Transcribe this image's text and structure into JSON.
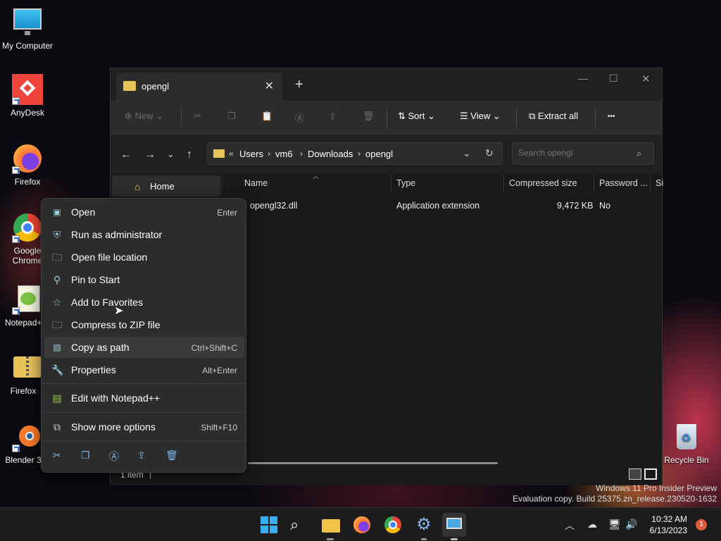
{
  "desktop": {
    "icons": [
      {
        "label": "My Computer"
      },
      {
        "label": "AnyDesk"
      },
      {
        "label": "Firefox"
      },
      {
        "label": "Google Chrome"
      },
      {
        "label": "Notepad++"
      },
      {
        "label": "Firefox"
      },
      {
        "label": "Blender 3"
      },
      {
        "label": "Recycle Bin"
      }
    ]
  },
  "window": {
    "tab_title": "opengl",
    "toolbar": {
      "new": "New",
      "sort": "Sort",
      "view": "View",
      "extract_all": "Extract all",
      "more": "•••"
    },
    "breadcrumb": [
      "Users",
      "vm6",
      "Downloads",
      "opengl"
    ],
    "search_placeholder": "Search opengl",
    "sidebar": {
      "home": "Home"
    },
    "columns": [
      "Name",
      "Type",
      "Compressed size",
      "Password ...",
      "Si"
    ],
    "rows": [
      {
        "name": "opengl32.dll",
        "type": "Application extension",
        "size": "9,472 KB",
        "password": "No"
      }
    ],
    "status": "1 item"
  },
  "context_menu": {
    "items": [
      {
        "label": "Open",
        "shortcut": "Enter"
      },
      {
        "label": "Run as administrator",
        "shortcut": ""
      },
      {
        "label": "Open file location",
        "shortcut": ""
      },
      {
        "label": "Pin to Start",
        "shortcut": ""
      },
      {
        "label": "Add to Favorites",
        "shortcut": ""
      },
      {
        "label": "Compress to ZIP file",
        "shortcut": ""
      },
      {
        "label": "Copy as path",
        "shortcut": "Ctrl+Shift+C"
      },
      {
        "label": "Properties",
        "shortcut": "Alt+Enter"
      },
      {
        "label": "Edit with Notepad++",
        "shortcut": ""
      },
      {
        "label": "Show more options",
        "shortcut": "Shift+F10"
      }
    ]
  },
  "watermark": {
    "line1": "Windows 11 Pro Insider Preview",
    "line2": "Evaluation copy. Build 25375.zn_release.230520-1632"
  },
  "clock": {
    "time": "10:32 AM",
    "date": "6/13/2023"
  },
  "notification_count": "1",
  "colors": {
    "accent": "#4cc2ff",
    "folder": "#e8c35a",
    "menu_bg": "#2c2c2c"
  }
}
